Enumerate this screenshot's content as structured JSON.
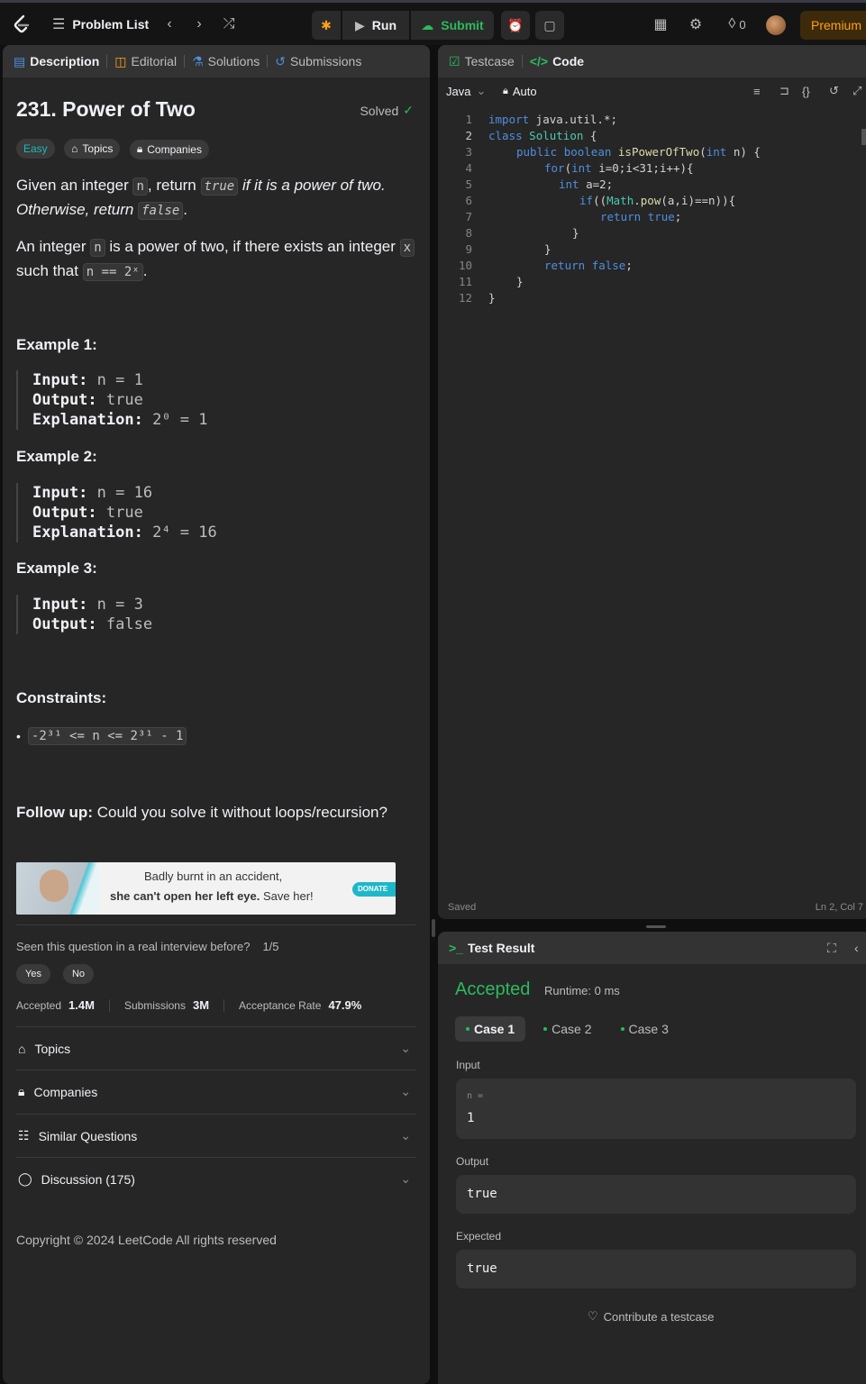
{
  "topbar": {
    "problem_list": "Problem List",
    "run": "Run",
    "submit": "Submit",
    "streak": "0",
    "premium": "Premium"
  },
  "left_tabs": [
    "Description",
    "Editorial",
    "Solutions",
    "Submissions"
  ],
  "problem": {
    "title": "231. Power of Two",
    "solved": "Solved",
    "tags": [
      "Easy",
      "Topics",
      "Companies"
    ],
    "p1a": "Given an integer ",
    "p1_n": "n",
    "p1b": ", return ",
    "p1_true": "true",
    "p1c": " if it is a power of two. Otherwise, return ",
    "p1_false": "false",
    "p1d": ".",
    "p2a": "An integer ",
    "p2_n": "n",
    "p2b": " is a power of two, if there exists an integer ",
    "p2_x": "x",
    "p2c": " such that ",
    "p2_eq": "n == 2ˣ",
    "p2d": "."
  },
  "examples": [
    {
      "title": "Example 1:",
      "input": "n = 1",
      "output": "true",
      "explanation": "2⁰ = 1"
    },
    {
      "title": "Example 2:",
      "input": "n = 16",
      "output": "true",
      "explanation": "2⁴ = 16"
    },
    {
      "title": "Example 3:",
      "input": "n = 3",
      "output": "false"
    }
  ],
  "labels": {
    "input": "Input:",
    "output": "Output:",
    "explanation": "Explanation:"
  },
  "constraints": {
    "title": "Constraints:",
    "item": "-2³¹ <= n <= 2³¹ - 1"
  },
  "followup": {
    "label": "Follow up:",
    "text": " Could you solve it without loops/recursion?"
  },
  "ad": {
    "line1": "Badly burnt in an accident,",
    "line2_bold": "she can't open her left eye.",
    "line2_rest": " Save her!",
    "donate": "DONATE"
  },
  "interview": {
    "question": "Seen this question in a real interview before?",
    "count": "1/5",
    "yes": "Yes",
    "no": "No"
  },
  "stats": {
    "accepted_label": "Accepted",
    "accepted": "1.4M",
    "submissions_label": "Submissions",
    "submissions": "3M",
    "rate_label": "Acceptance Rate",
    "rate": "47.9%"
  },
  "accordions": [
    "Topics",
    "Companies",
    "Similar Questions",
    "Discussion (175)"
  ],
  "copyright": "Copyright © 2024 LeetCode All rights reserved",
  "code_tabs": [
    "Testcase",
    "Code"
  ],
  "editor": {
    "language": "Java",
    "mode": "Auto",
    "saved": "Saved",
    "cursor": "Ln 2, Col 7"
  },
  "result": {
    "title": "Test Result",
    "status": "Accepted",
    "runtime": "Runtime: 0 ms",
    "cases": [
      "Case 1",
      "Case 2",
      "Case 3"
    ],
    "input_label": "Input",
    "param": "n =",
    "input_value": "1",
    "output_label": "Output",
    "output_value": "true",
    "expected_label": "Expected",
    "expected_value": "true",
    "contribute": "Contribute a testcase"
  },
  "colors": {
    "accent_orange": "#ffa116",
    "green": "#2cbb5d",
    "easy": "#1cbaba"
  }
}
